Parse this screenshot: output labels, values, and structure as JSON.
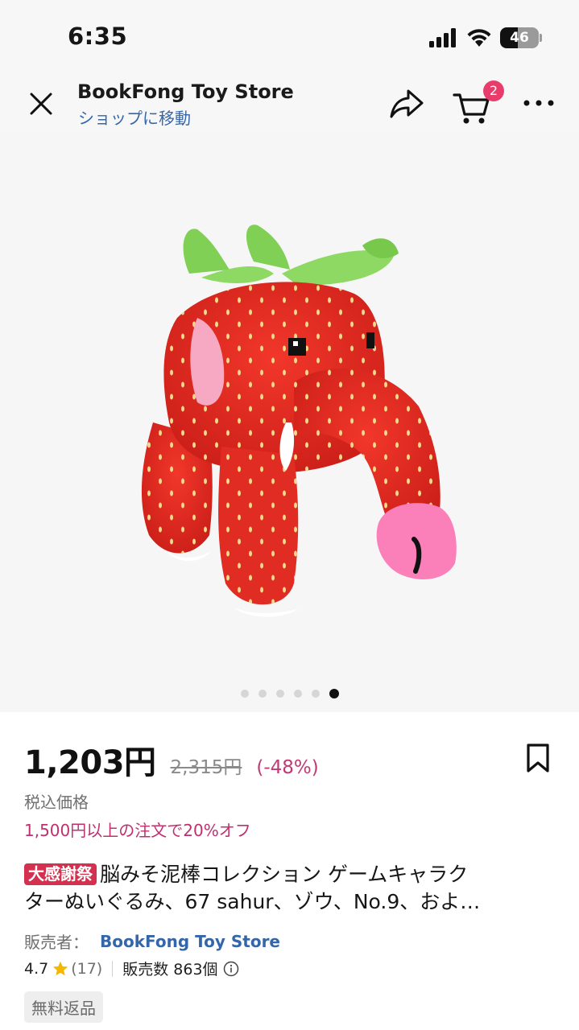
{
  "status": {
    "time": "6:35",
    "battery": "46",
    "battery_level": 0.46
  },
  "header": {
    "store_name": "BookFong Toy Store",
    "store_link": "ショップに移動",
    "cart_count": "2"
  },
  "gallery": {
    "image_count": 6,
    "active_index": 5
  },
  "product": {
    "price": "1,203円",
    "original_price": "2,315円",
    "discount": "(-48%)",
    "tax_label": "税込価格",
    "promo": "1,500円以上の注文で20%オフ",
    "campaign_tag": "大感謝祭",
    "title_line1": "脳みそ泥棒コレクション ゲームキャラク",
    "title_line2": "ターぬいぐるみ、67 sahur、ゾウ、No.9、およ…",
    "seller_label": "販売者：",
    "seller_name": "BookFong Toy Store",
    "rating": "4.7",
    "rating_count": "(17)",
    "sold": "販売数 863個",
    "free_return": "無料返品"
  },
  "colors": {
    "accent": "#e83d6a",
    "link": "#3566a8",
    "promo": "#c0306e",
    "tag": "#d4304f"
  }
}
